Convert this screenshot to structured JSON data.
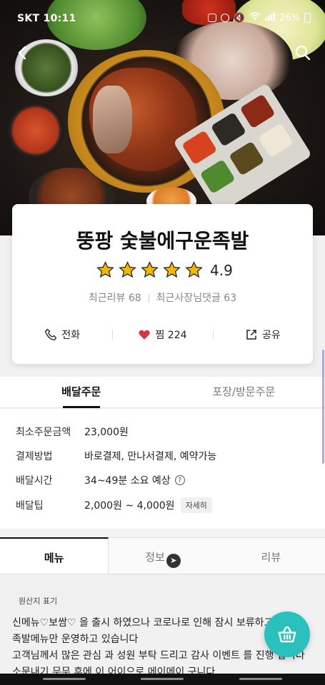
{
  "status_bar": {
    "carrier_time": "SKT 10:11",
    "battery": "26%"
  },
  "store": {
    "name": "뚱팡 숯불에구운족발",
    "rating": "4.9",
    "stars": 5,
    "recent_reviews": "최근리뷰 68",
    "owner_replies": "최근사장님댓글 63"
  },
  "actions": {
    "call": "전화",
    "like": "찜 224",
    "share": "공유"
  },
  "order_tabs": [
    "배달주문",
    "포장/방문주문"
  ],
  "info_rows": [
    {
      "key": "최소주문금액",
      "value": "23,000원"
    },
    {
      "key": "결제방법",
      "value": "바로결제, 만나서결제, 예약가능"
    },
    {
      "key": "배달시간",
      "value": "34~49분 소요 예상"
    },
    {
      "key": "배달팁",
      "value": "2,000원 ~ 4,000원",
      "button": "자세히"
    }
  ],
  "menu_tabs": {
    "menu": "메뉴",
    "info": "정보",
    "review": "리뷰"
  },
  "origin_label": "원산지 표기",
  "notice": "신메뉴♡보쌈♡ 을 출시 하였으나 코로나로 인해 잠시 보류하고\n족발메뉴만 운영하고 있습니다\n고객님께서 많은 관심 과 성원 부탁 드리고 감사 이벤트 를 진행 합니다\n소문내기 무무 후에 이 어이으로 메이메이 구니다",
  "colors": {
    "accent": "#2ac1bc",
    "star": "#f5b800",
    "heart": "#e0303f"
  }
}
